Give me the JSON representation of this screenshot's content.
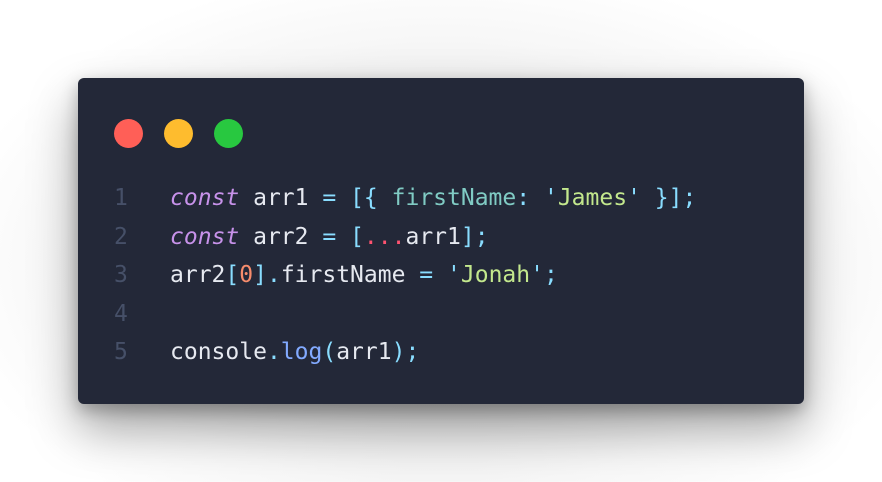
{
  "colors": {
    "page_background": "#ffffff",
    "editor_background": "#232838",
    "line_number": "#465068",
    "default_text": "#e6e9f0",
    "keyword": "#c792ea",
    "property": "#80cbc4",
    "string": "#c3e88d",
    "punctuation": "#89ddff",
    "spread": "#ff5370",
    "number": "#f78c6c",
    "method": "#82aaff",
    "dot_red": "#ff5f57",
    "dot_yellow": "#febc2e",
    "dot_green": "#28c840"
  },
  "window_controls": [
    {
      "name": "close-dot",
      "color": "#ff5f57"
    },
    {
      "name": "minimize-dot",
      "color": "#febc2e"
    },
    {
      "name": "zoom-dot",
      "color": "#28c840"
    }
  ],
  "code": {
    "lines": [
      {
        "number": "1",
        "tokens": [
          {
            "text": "const",
            "color": "#c792ea",
            "italic": true
          },
          {
            "text": " arr1 ",
            "color": "#e6e9f0"
          },
          {
            "text": "=",
            "color": "#89ddff"
          },
          {
            "text": " ",
            "color": "#e6e9f0"
          },
          {
            "text": "[{",
            "color": "#89ddff"
          },
          {
            "text": " ",
            "color": "#e6e9f0"
          },
          {
            "text": "firstName",
            "color": "#80cbc4"
          },
          {
            "text": ":",
            "color": "#89ddff"
          },
          {
            "text": " ",
            "color": "#e6e9f0"
          },
          {
            "text": "'",
            "color": "#89ddff"
          },
          {
            "text": "James",
            "color": "#c3e88d"
          },
          {
            "text": "'",
            "color": "#89ddff"
          },
          {
            "text": " ",
            "color": "#e6e9f0"
          },
          {
            "text": "}]",
            "color": "#89ddff"
          },
          {
            "text": ";",
            "color": "#89ddff"
          }
        ]
      },
      {
        "number": "2",
        "tokens": [
          {
            "text": "const",
            "color": "#c792ea",
            "italic": true
          },
          {
            "text": " arr2 ",
            "color": "#e6e9f0"
          },
          {
            "text": "=",
            "color": "#89ddff"
          },
          {
            "text": " ",
            "color": "#e6e9f0"
          },
          {
            "text": "[",
            "color": "#89ddff"
          },
          {
            "text": "...",
            "color": "#ff5370"
          },
          {
            "text": "arr1",
            "color": "#e6e9f0"
          },
          {
            "text": "];",
            "color": "#89ddff"
          }
        ]
      },
      {
        "number": "3",
        "tokens": [
          {
            "text": "arr2",
            "color": "#e6e9f0"
          },
          {
            "text": "[",
            "color": "#89ddff"
          },
          {
            "text": "0",
            "color": "#f78c6c"
          },
          {
            "text": "].",
            "color": "#89ddff"
          },
          {
            "text": "firstName",
            "color": "#e6e9f0"
          },
          {
            "text": " ",
            "color": "#e6e9f0"
          },
          {
            "text": "=",
            "color": "#89ddff"
          },
          {
            "text": " ",
            "color": "#e6e9f0"
          },
          {
            "text": "'",
            "color": "#89ddff"
          },
          {
            "text": "Jonah",
            "color": "#c3e88d"
          },
          {
            "text": "'",
            "color": "#89ddff"
          },
          {
            "text": ";",
            "color": "#89ddff"
          }
        ]
      },
      {
        "number": "4",
        "tokens": []
      },
      {
        "number": "5",
        "tokens": [
          {
            "text": "console",
            "color": "#e6e9f0"
          },
          {
            "text": ".",
            "color": "#89ddff"
          },
          {
            "text": "log",
            "color": "#82aaff"
          },
          {
            "text": "(",
            "color": "#89ddff"
          },
          {
            "text": "arr1",
            "color": "#e6e9f0"
          },
          {
            "text": ");",
            "color": "#89ddff"
          }
        ]
      }
    ]
  }
}
